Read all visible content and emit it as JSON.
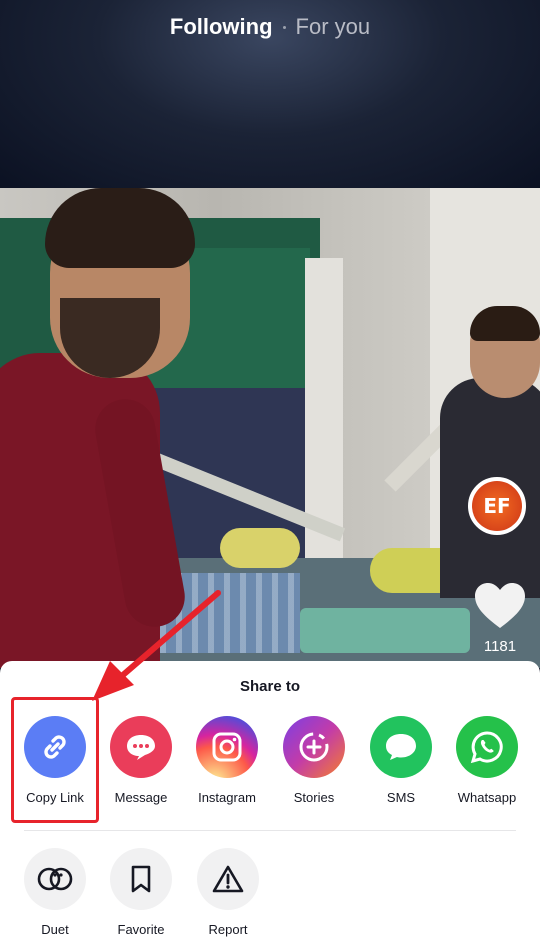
{
  "top_tabs": {
    "following": "Following",
    "for_you": "For you"
  },
  "creator": {
    "avatar_text": "EF"
  },
  "likes": {
    "count": "1181"
  },
  "share_sheet": {
    "title": "Share to",
    "targets": [
      {
        "label": "Copy Link",
        "icon": "link-icon",
        "color": "#5b7df5"
      },
      {
        "label": "Message",
        "icon": "message-bubble-icon",
        "color": "#ea3d5a"
      },
      {
        "label": "Instagram",
        "icon": "instagram-icon",
        "color": "#d6249f"
      },
      {
        "label": "Stories",
        "icon": "stories-plus-icon",
        "color": "#c33ca8"
      },
      {
        "label": "SMS",
        "icon": "sms-bubble-icon",
        "color": "#22c35e"
      },
      {
        "label": "Whatsapp",
        "icon": "whatsapp-icon",
        "color": "#25c14a"
      }
    ],
    "actions": [
      {
        "label": "Duet",
        "icon": "duet-icon"
      },
      {
        "label": "Favorite",
        "icon": "bookmark-icon"
      },
      {
        "label": "Report",
        "icon": "warning-triangle-icon"
      }
    ]
  },
  "colors": {
    "highlight": "#e7232b",
    "sheet_bg": "#ffffff",
    "action_bg": "#f1f1f2"
  }
}
